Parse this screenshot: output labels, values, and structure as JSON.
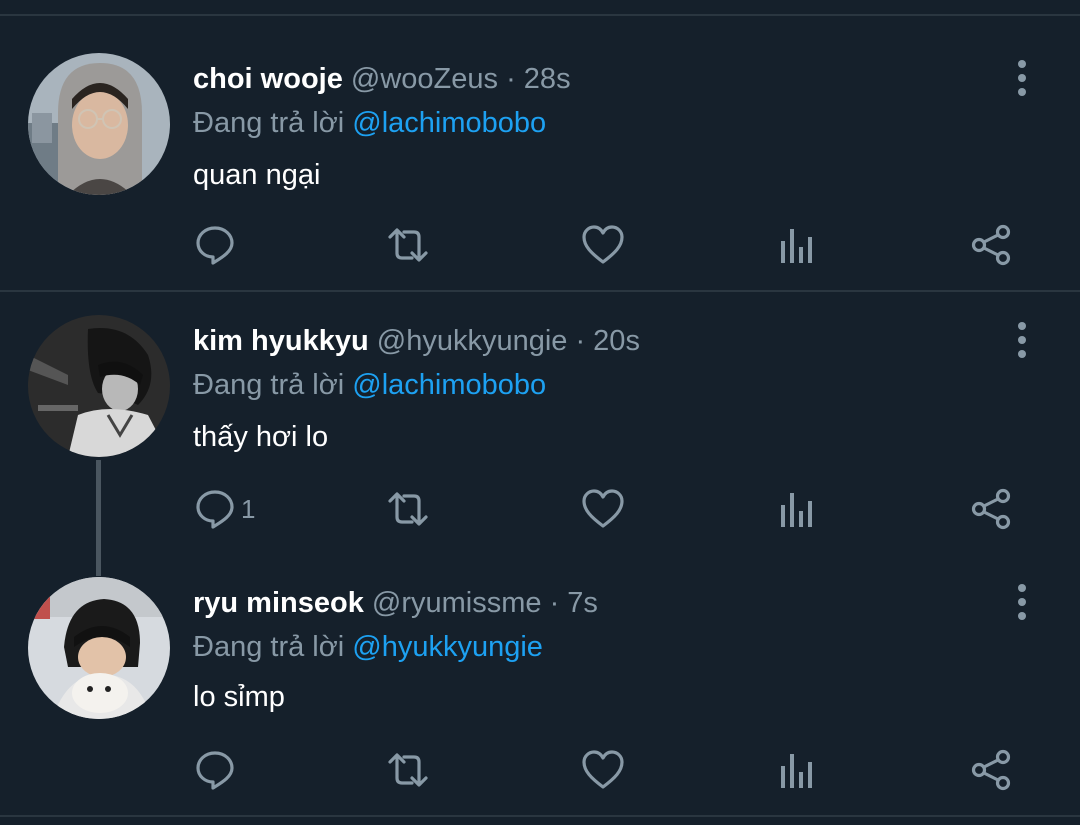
{
  "tweets": [
    {
      "name": "choi wooje",
      "handle": "@wooZeus",
      "time": "· 28s",
      "reply_prefix": "Đang trả lời",
      "reply_to": "@lachimobobo",
      "text": "quan ngại",
      "reply_count": ""
    },
    {
      "name": "kim hyukkyu",
      "handle": "@hyukkyungie",
      "time": "· 20s",
      "reply_prefix": "Đang trả lời",
      "reply_to": "@lachimobobo",
      "text": "thấy hơi lo",
      "reply_count": "1"
    },
    {
      "name": "ryu minseok",
      "handle": "@ryumissme",
      "time": "· 7s",
      "reply_prefix": "Đang trả lời",
      "reply_to": "@hyukkyungie",
      "text": "lo sỉmp",
      "reply_count": ""
    }
  ],
  "icons": {
    "reply": "reply-icon",
    "retweet": "retweet-icon",
    "like": "heart-icon",
    "analytics": "analytics-icon",
    "share": "share-icon",
    "more": "more-vertical-icon"
  },
  "colors": {
    "background": "#15202b",
    "mention": "#1da1f2",
    "secondary_text": "#8899a6",
    "icon": "#8899a6"
  }
}
